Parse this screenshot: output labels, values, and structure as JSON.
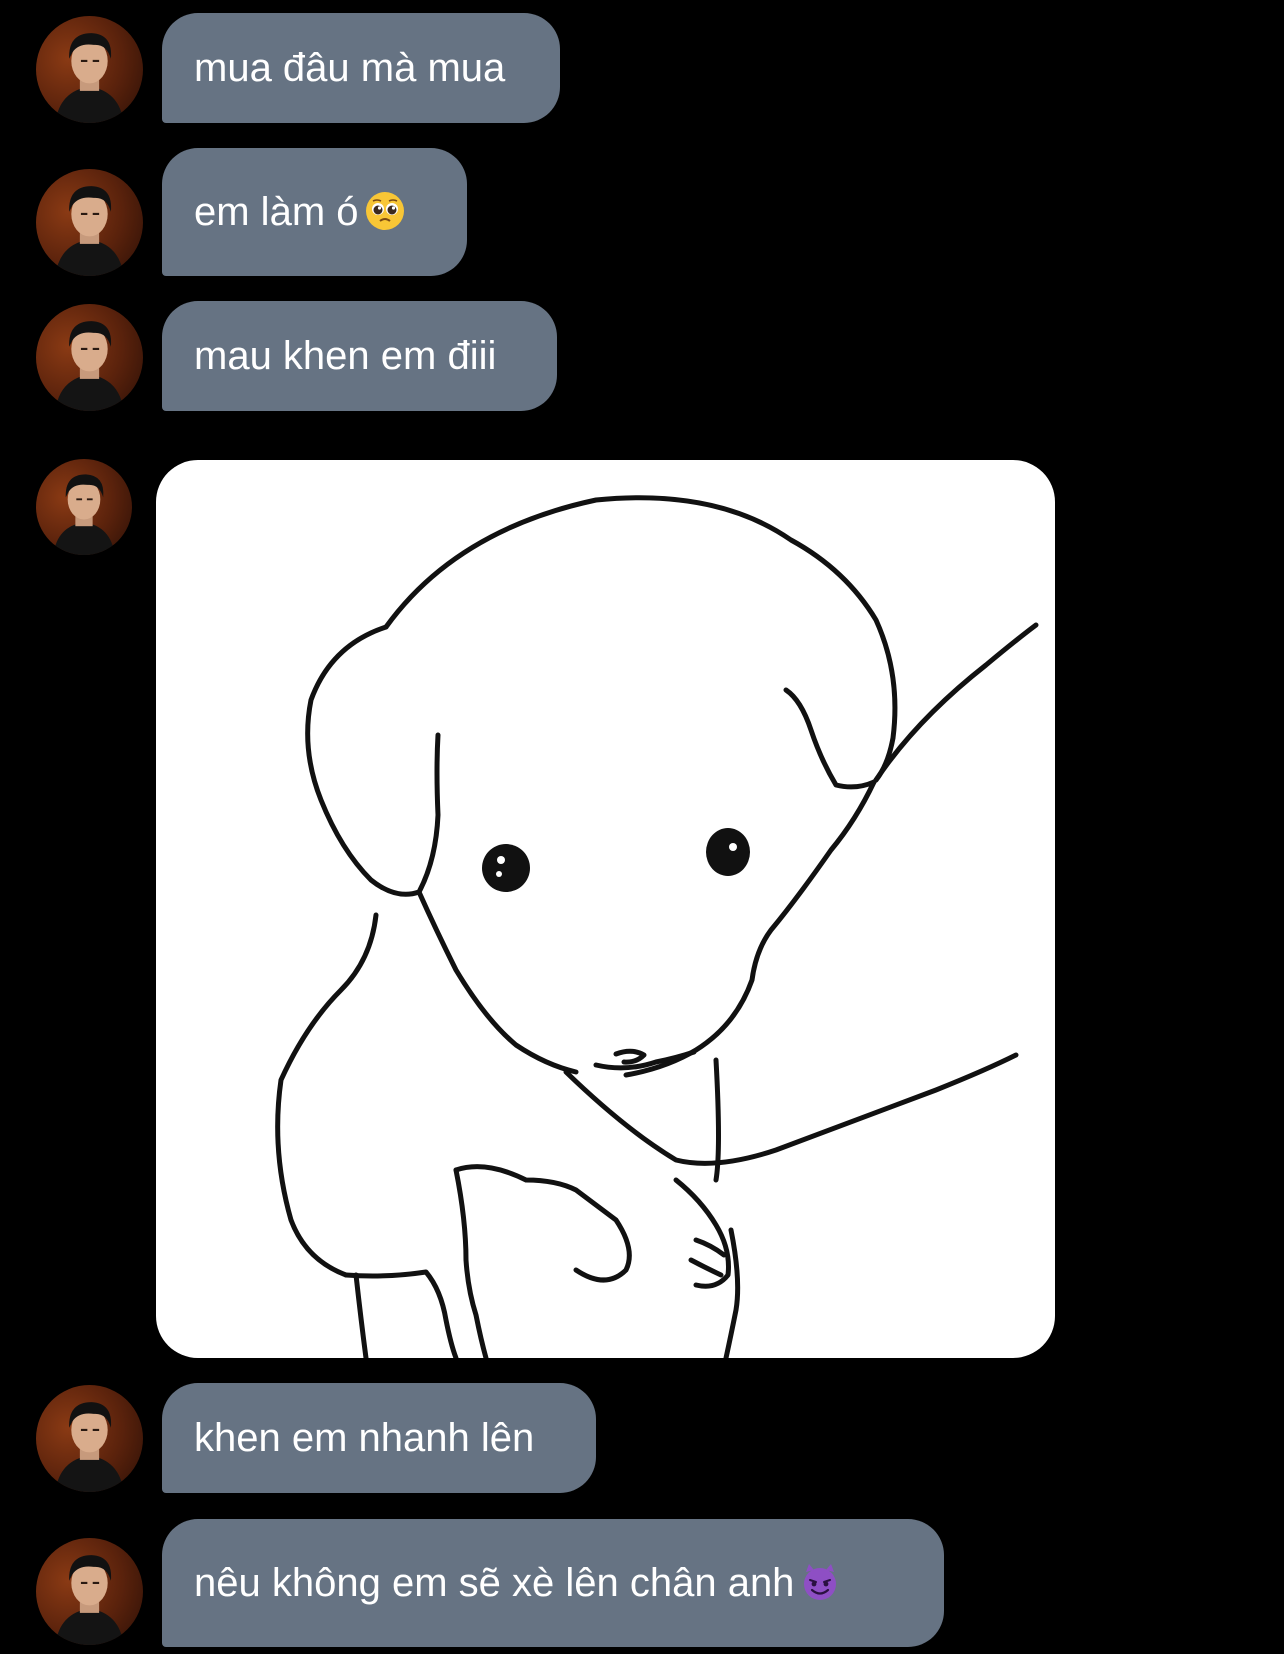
{
  "conversation": {
    "messages": [
      {
        "type": "text",
        "text": "mua đâu mà mua"
      },
      {
        "type": "text",
        "text": "em làm ó",
        "emoji": "pleading-face-icon"
      },
      {
        "type": "text",
        "text": "mau khen em điii"
      },
      {
        "type": "image",
        "image": "puppy-line-drawing"
      },
      {
        "type": "text",
        "text": "khen em nhanh lên"
      },
      {
        "type": "text",
        "text": "nêu không em sẽ xè lên chân anh",
        "emoji": "smiling-devil-icon"
      }
    ]
  },
  "colors": {
    "background": "#000000",
    "bubble": "#667383",
    "text": "#ffffff"
  }
}
